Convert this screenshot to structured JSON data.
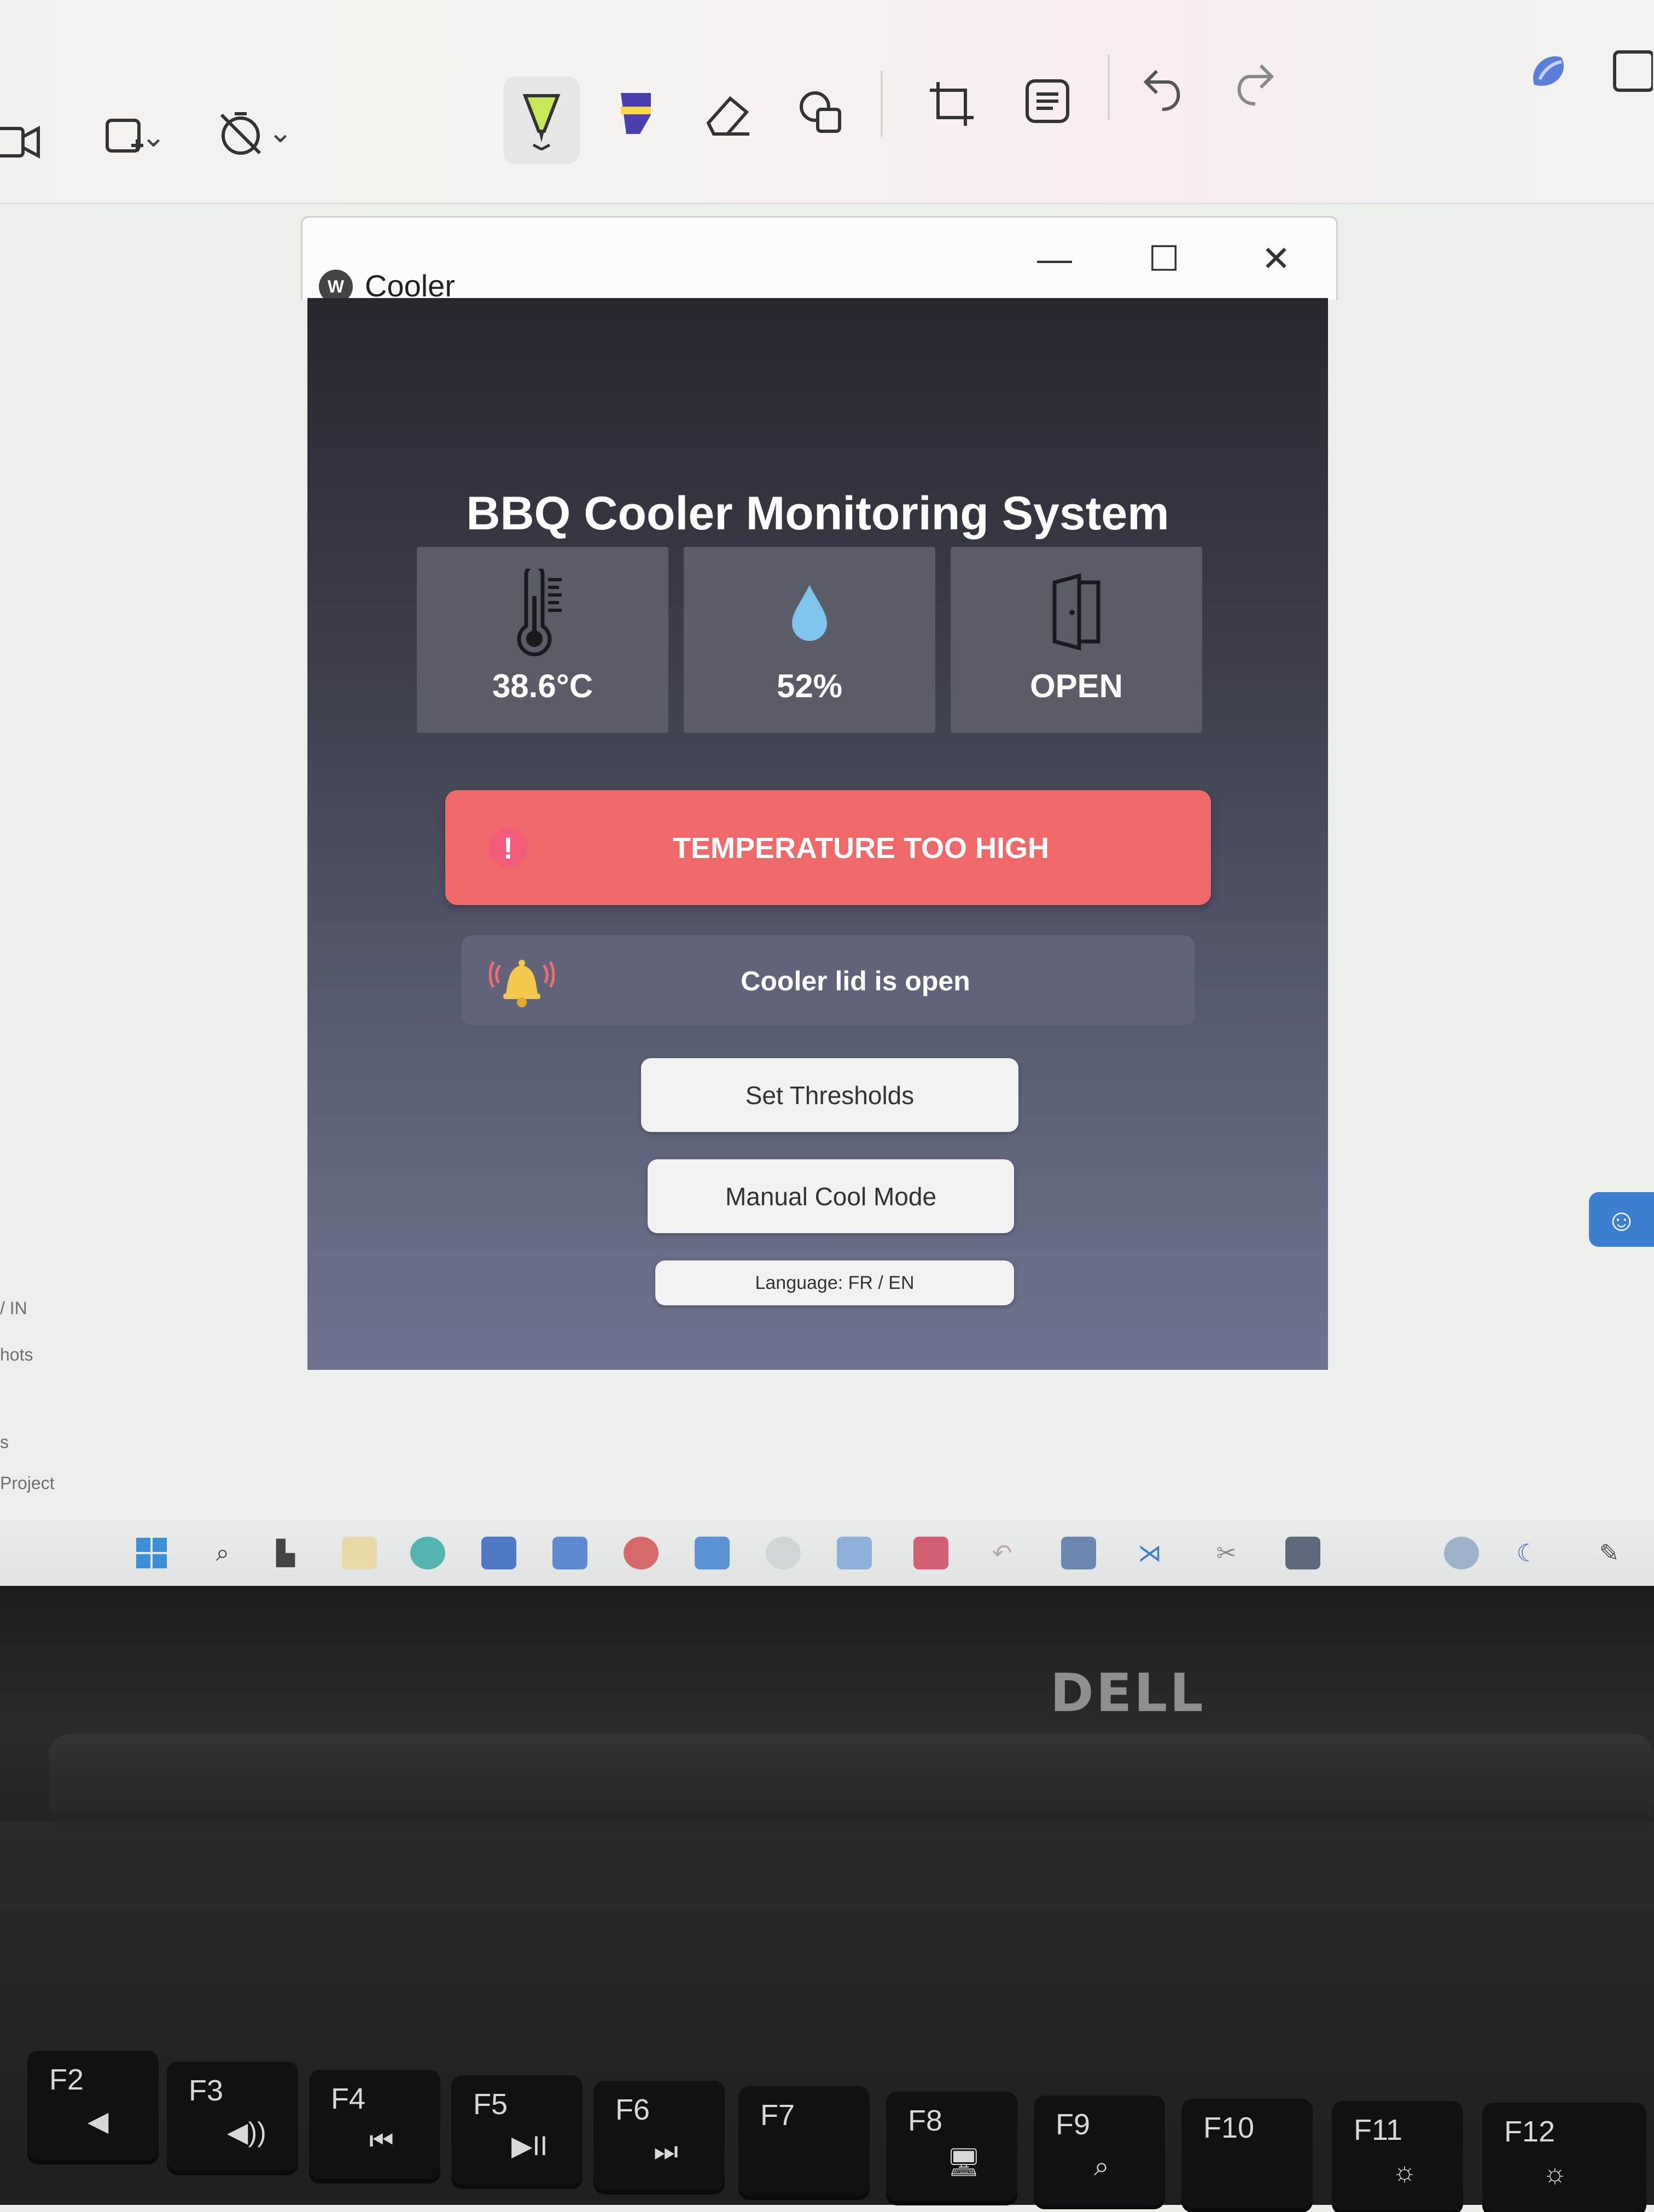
{
  "window": {
    "title": "Cooler",
    "icon_glyph": "W",
    "controls": {
      "minimize": "—",
      "maximize": "☐",
      "close": "✕"
    }
  },
  "dashboard": {
    "heading": "BBQ Cooler Monitoring System",
    "cards": [
      {
        "icon": "thermometer-icon",
        "value": "38.6°C"
      },
      {
        "icon": "water-drop-icon",
        "value": "52%"
      },
      {
        "icon": "door-icon",
        "value": "OPEN"
      }
    ],
    "alert": {
      "icon_glyph": "!",
      "text": "TEMPERATURE TOO HIGH",
      "color": "#f0696a"
    },
    "notice": {
      "icon": "bell-icon",
      "text": "Cooler lid is open"
    },
    "buttons": {
      "thresholds": "Set Thresholds",
      "manual_cool": "Manual Cool Mode",
      "language": "Language: FR / EN"
    }
  },
  "desktop_fragments": [
    "/ IN",
    "hots",
    "s",
    "Project"
  ],
  "laptop": {
    "brand": "DELL",
    "fkeys": [
      "F2",
      "F3",
      "F4",
      "F5",
      "F6",
      "F7",
      "F8",
      "F9",
      "F10",
      "F11",
      "F12"
    ],
    "fkey_glyphs": [
      "◀",
      "◀))",
      "⏮",
      "▶II",
      "⏭",
      "",
      "🖥",
      "⌕",
      "",
      "☼",
      "☼"
    ]
  },
  "colors": {
    "panel_top": "#27282e",
    "panel_bottom": "#6f7390",
    "card": "#5a5c68",
    "alert": "#f0696a",
    "notice": "#60637a",
    "button": "#f2f2f2",
    "accent_blue": "#3c7fd0"
  }
}
